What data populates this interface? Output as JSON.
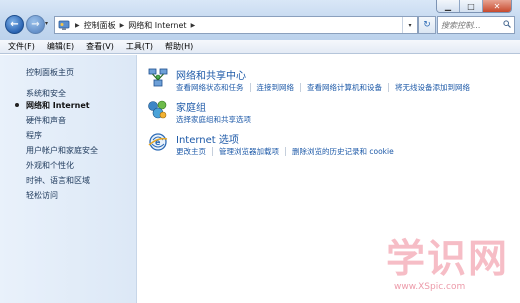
{
  "window": {
    "buttons": {
      "minimize": "▁",
      "maximize": "□",
      "close": "✕"
    }
  },
  "nav": {
    "back": "←",
    "forward": "→",
    "recent": "▾"
  },
  "address": {
    "icon": "control-panel-icon",
    "breadcrumbs": [
      "控制面板",
      "网络和 Internet"
    ],
    "dropdown": "▾"
  },
  "refresh": "↻",
  "search": {
    "placeholder": "搜索控制..."
  },
  "menu": {
    "items": [
      "文件(F)",
      "编辑(E)",
      "查看(V)",
      "工具(T)",
      "帮助(H)"
    ]
  },
  "sidebar": {
    "items": [
      {
        "label": "控制面板主页",
        "active": false
      },
      {
        "label": "系统和安全",
        "active": false
      },
      {
        "label": "网络和 Internet",
        "active": true
      },
      {
        "label": "硬件和声音",
        "active": false
      },
      {
        "label": "程序",
        "active": false
      },
      {
        "label": "用户帐户和家庭安全",
        "active": false
      },
      {
        "label": "外观和个性化",
        "active": false
      },
      {
        "label": "时钟、语言和区域",
        "active": false
      },
      {
        "label": "轻松访问",
        "active": false
      }
    ]
  },
  "categories": [
    {
      "title": "网络和共享中心",
      "icon": "network-icon",
      "links": [
        "查看网络状态和任务",
        "连接到网络",
        "查看网络计算机和设备",
        "将无线设备添加到网络"
      ]
    },
    {
      "title": "家庭组",
      "icon": "homegroup-icon",
      "links": [
        "选择家庭组和共享选项"
      ]
    },
    {
      "title": "Internet 选项",
      "icon": "internet-options-icon",
      "links": [
        "更改主页",
        "管理浏览器加载项",
        "删除浏览的历史记录和 cookie"
      ]
    }
  ],
  "watermark": {
    "big": "学识网",
    "small": "www.XSpic.com"
  },
  "colors": {
    "link": "#1e5aa8",
    "sidebar_bg": "#e3edf9",
    "titlebar": "#c4d8ef"
  }
}
